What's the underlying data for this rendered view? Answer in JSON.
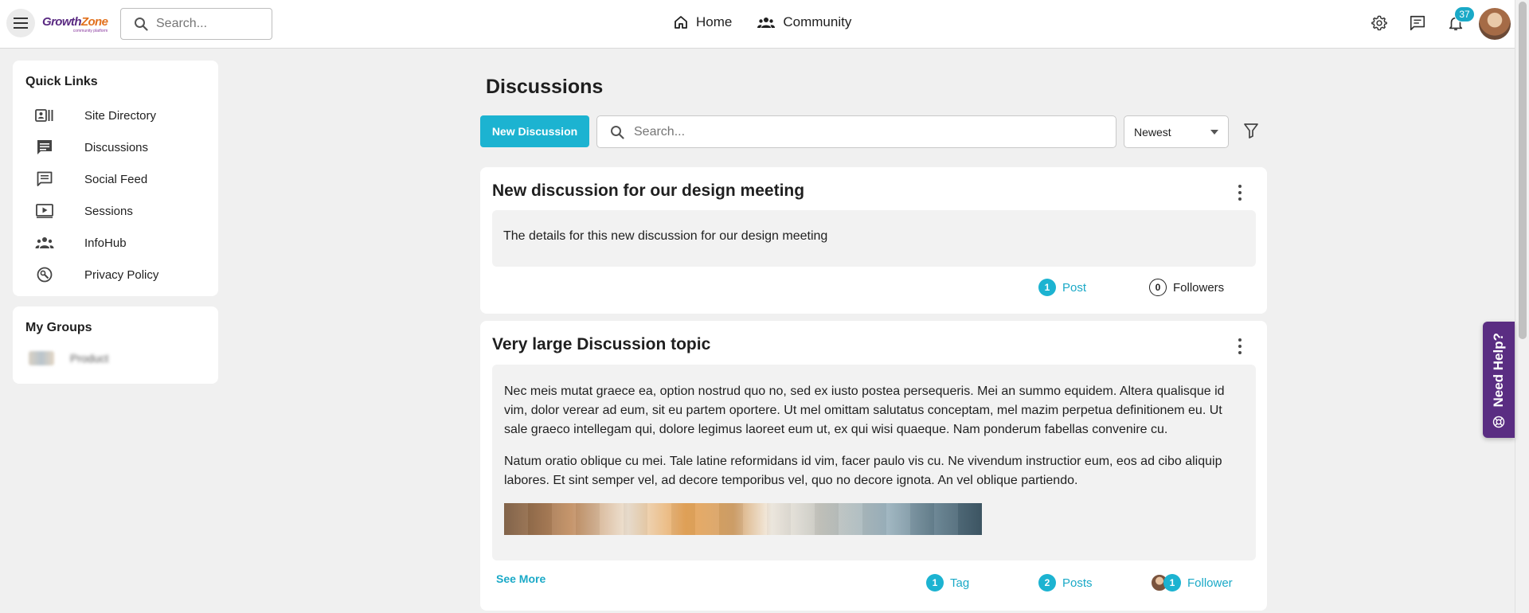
{
  "header": {
    "logo_main_a": "Growth",
    "logo_main_b": "Zone",
    "logo_sub": "community platform",
    "search_placeholder": "Search...",
    "nav": [
      {
        "label": "Home",
        "icon": "home-icon"
      },
      {
        "label": "Community",
        "icon": "community-icon"
      }
    ],
    "notification_count": "37"
  },
  "sidebar": {
    "quick_links_title": "Quick Links",
    "quick_links": [
      {
        "label": "Site Directory",
        "icon": "directory-icon"
      },
      {
        "label": "Discussions",
        "icon": "discussion-icon"
      },
      {
        "label": "Social Feed",
        "icon": "feed-icon"
      },
      {
        "label": "Sessions",
        "icon": "sessions-icon"
      },
      {
        "label": "InfoHub",
        "icon": "infohub-icon"
      },
      {
        "label": "Privacy Policy",
        "icon": "privacy-icon"
      }
    ],
    "my_groups_title": "My Groups",
    "groups": [
      {
        "label": "Product"
      }
    ]
  },
  "main": {
    "title": "Discussions",
    "new_button": "New Discussion",
    "search_placeholder": "Search...",
    "sort_selected": "Newest",
    "discussions": [
      {
        "title": "New discussion for our design meeting",
        "body": "The details for this new discussion for our design meeting",
        "posts_count": "1",
        "posts_label": "Post",
        "followers_count": "0",
        "followers_label": "Followers"
      },
      {
        "title": "Very large Discussion topic",
        "paragraphs": [
          "Nec meis mutat graece ea, option nostrud quo no, sed ex iusto postea persequeris. Mei an summo equidem. Altera qualisque id vim, dolor verear ad eum, sit eu partem oportere. Ut mel omittam salutatus conceptam, mel mazim perpetua definitionem eu. Ut sale graeco intellegam qui, dolore legimus laoreet eum ut, ex qui wisi quaeque. Nam ponderum fabellas convenire cu.",
          "Natum oratio oblique cu mei. Tale latine reformidans id vim, facer paulo vis cu. Ne vivendum instructior eum, eos ad cibo aliquip labores. Et sint semper vel, ad decore temporibus vel, quo no decore ignota. An vel oblique partiendo."
        ],
        "see_more": "See More",
        "tags_count": "1",
        "tags_label": "Tag",
        "posts_count": "2",
        "posts_label": "Posts",
        "followers_count": "1",
        "followers_label": "Follower"
      }
    ]
  },
  "help": {
    "label": "Need Help?"
  },
  "colors": {
    "accent": "#1cb3d1",
    "help_tab": "#5a2d82"
  }
}
